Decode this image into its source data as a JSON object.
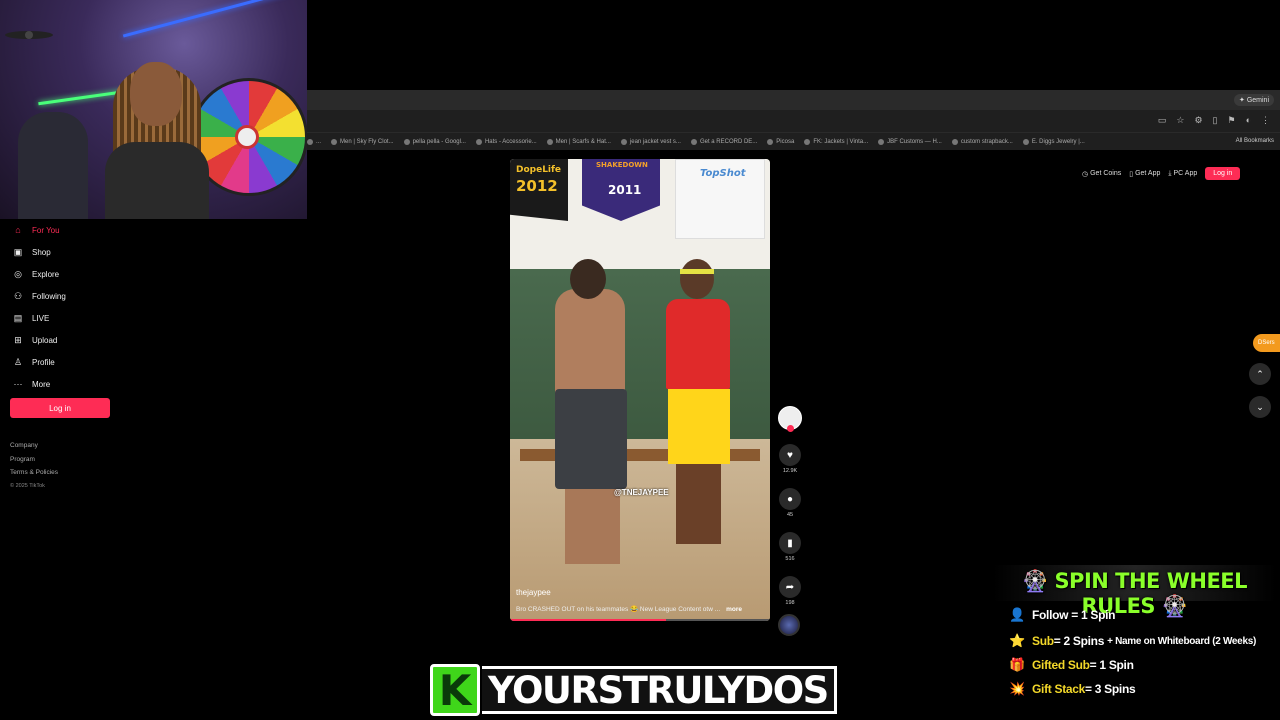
{
  "browser": {
    "gemini_label": "✦ Gemini",
    "bookmarks": [
      "...",
      "Men | Sky Fly Clot...",
      "pella pella - Googl...",
      "Hats - Accessorie...",
      "Men | Scarfs & Hat...",
      "jean jacket vest s...",
      "Get a RECORD DE...",
      "Picosa",
      "FK: Jackets | Vinta...",
      "JBF Customs — H...",
      "custom strapback...",
      "E. Diggs Jewelry |..."
    ],
    "all_bookmarks": "All Bookmarks"
  },
  "sidebar": {
    "items": [
      {
        "label": "For You",
        "icon": "home-icon"
      },
      {
        "label": "Shop",
        "icon": "shop-icon"
      },
      {
        "label": "Explore",
        "icon": "compass-icon"
      },
      {
        "label": "Following",
        "icon": "following-icon"
      },
      {
        "label": "LIVE",
        "icon": "live-icon"
      },
      {
        "label": "Upload",
        "icon": "upload-icon"
      },
      {
        "label": "Profile",
        "icon": "profile-icon"
      },
      {
        "label": "More",
        "icon": "more-icon"
      }
    ],
    "login_label": "Log in",
    "footer": [
      "Company",
      "Program",
      "Terms & Policies"
    ],
    "copyright": "© 2025 TikTok"
  },
  "top_actions": {
    "get_coins": "Get Coins",
    "get_app": "Get App",
    "pc_app": "PC App",
    "login": "Log in"
  },
  "video": {
    "banners": [
      "DopeLife 2012",
      "SHAKEDOWN 2011",
      "TOPSHOT"
    ],
    "banner1_top": "DopeLife",
    "banner1_year": "2012",
    "banner2_top": "SHAKEDOWN",
    "banner2_year": "2011",
    "banner3": "TopShot",
    "watermark": "@TNEJAYPEE",
    "author": "thejaypee",
    "caption": "Bro CRASHED OUT on his teammates 😂 New League Content otw ...",
    "more": "more",
    "progress": 0.6
  },
  "actions": {
    "likes": "12.9K",
    "comments": "45",
    "saves": "516",
    "shares": "198"
  },
  "right_nav": {
    "dsers": "DSers"
  },
  "overlay": {
    "title": "SPIN THE WHEEL RULES",
    "rules": [
      {
        "icon": "👤",
        "prefix": "",
        "text": "Follow = 1 Spin",
        "extra": ""
      },
      {
        "icon": "⭐",
        "prefix": "Sub",
        "text": " = 2 Spins",
        "extra": "+ Name on Whiteboard (2 Weeks)"
      },
      {
        "icon": "🎁",
        "prefix": "Gifted Sub",
        "text": " = 1 Spin",
        "extra": ""
      },
      {
        "icon": "💥",
        "prefix": "Gift Stack",
        "text": " = 3 Spins",
        "extra": ""
      }
    ],
    "kick_logo": "K",
    "streamer_name": "YOURSTRULYDOS"
  }
}
